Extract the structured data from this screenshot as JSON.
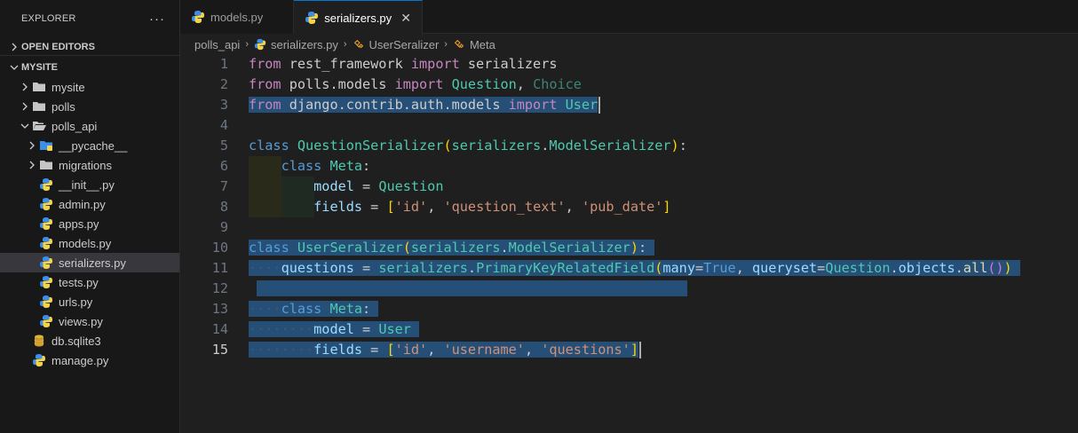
{
  "explorer": {
    "title": "EXPLORER",
    "more": "···",
    "open_editors": "OPEN EDITORS",
    "project": "MYSITE",
    "items": [
      {
        "label": "mysite"
      },
      {
        "label": "polls"
      },
      {
        "label": "polls_api"
      },
      {
        "label": "__pycache__"
      },
      {
        "label": "migrations"
      },
      {
        "label": "__init__.py"
      },
      {
        "label": "admin.py"
      },
      {
        "label": "apps.py"
      },
      {
        "label": "models.py"
      },
      {
        "label": "serializers.py"
      },
      {
        "label": "tests.py"
      },
      {
        "label": "urls.py"
      },
      {
        "label": "views.py"
      },
      {
        "label": "db.sqlite3"
      },
      {
        "label": "manage.py"
      }
    ]
  },
  "tabs": [
    {
      "label": "models.py"
    },
    {
      "label": "serializers.py",
      "close": "✕"
    }
  ],
  "breadcrumb": [
    "polls_api",
    "serializers.py",
    "UserSeralizer",
    "Meta"
  ],
  "line_numbers": [
    "1",
    "2",
    "3",
    "4",
    "5",
    "6",
    "7",
    "8",
    "9",
    "10",
    "11",
    "12",
    "13",
    "14",
    "15"
  ],
  "code": {
    "l1": [
      "from",
      " rest_framework ",
      "import",
      " serializers"
    ],
    "l2": [
      "from",
      " polls.models ",
      "import",
      " Question",
      ", ",
      "Choice"
    ],
    "l3": [
      "from",
      " django.contrib.auth.models ",
      "import",
      " User"
    ],
    "l5": [
      "class",
      " ",
      "QuestionSerializer",
      "(",
      "serializers",
      ".",
      "ModelSerializer",
      ")",
      ":"
    ],
    "l6": [
      "class",
      " ",
      "Meta",
      ":"
    ],
    "l7": [
      "model",
      " = ",
      "Question"
    ],
    "l8": [
      "fields",
      " = ",
      "[",
      "'id'",
      ", ",
      "'question_text'",
      ", ",
      "'pub_date'",
      "]"
    ],
    "l10": [
      "class",
      " ",
      "UserSeralizer",
      "(",
      "serializers",
      ".",
      "ModelSerializer",
      ")",
      ":"
    ],
    "l11": [
      "questions",
      " = ",
      "serializers",
      ".",
      "PrimaryKeyRelatedField",
      "(",
      "many",
      "=",
      "True",
      ", ",
      "queryset",
      "=",
      "Question",
      ".",
      "objects",
      ".",
      "all",
      "(",
      ")",
      ")"
    ],
    "l13": [
      "class",
      " ",
      "Meta",
      ":"
    ],
    "l14": [
      "model",
      " = ",
      "User"
    ],
    "l15": [
      "fields",
      " = ",
      "[",
      "'id'",
      ", ",
      "'username'",
      ", ",
      "'questions'",
      "]"
    ]
  },
  "colors": {
    "accent": "#0078d4",
    "selection": "#264f78",
    "keyword": "#c586c0",
    "class": "#4ec9b0",
    "string": "#ce9178"
  }
}
